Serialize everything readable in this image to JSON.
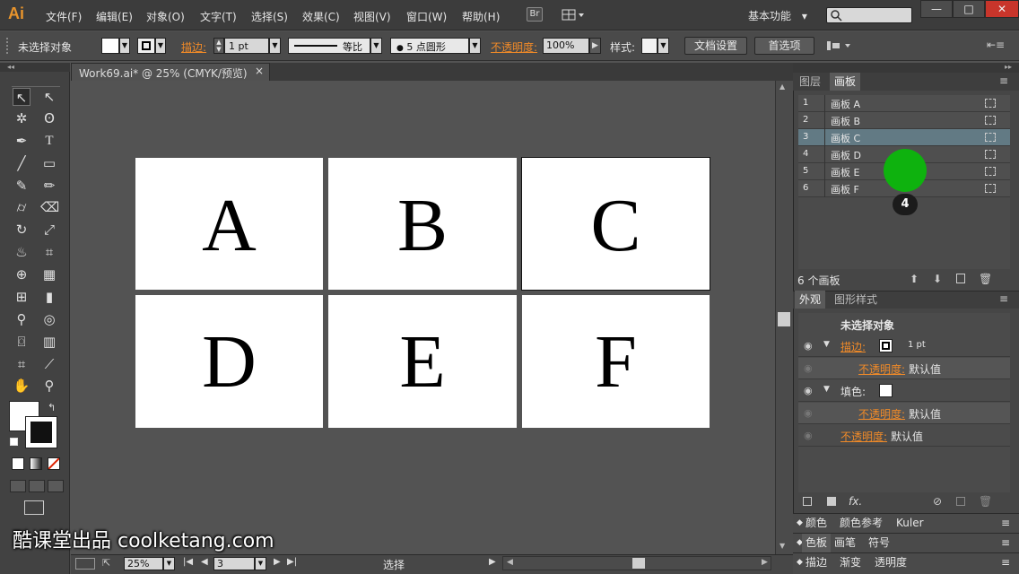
{
  "app": {
    "logo": "Ai"
  },
  "menu": [
    "文件(F)",
    "编辑(E)",
    "对象(O)",
    "文字(T)",
    "选择(S)",
    "效果(C)",
    "视图(V)",
    "窗口(W)",
    "帮助(H)"
  ],
  "bridge_button": "Br",
  "workspace": {
    "label": "基本功能",
    "chevron": "▾"
  },
  "window_controls": {
    "minimize": "—",
    "restore": "□",
    "close": "✕"
  },
  "control_bar": {
    "selection_status": "未选择对象",
    "stroke_label": "描边:",
    "stroke_weight": "1 pt",
    "stroke_profile": "等比",
    "brush": "5 点圆形",
    "opacity_label": "不透明度:",
    "opacity_value": "100%",
    "style_label": "样式:",
    "doc_setup_button": "文档设置",
    "preferences_button": "首选项"
  },
  "document": {
    "tab_title": "Work69.ai* @ 25% (CMYK/预览)",
    "close_glyph": "×"
  },
  "artboards": [
    {
      "label": "A"
    },
    {
      "label": "B"
    },
    {
      "label": "C"
    },
    {
      "label": "D"
    },
    {
      "label": "E"
    },
    {
      "label": "F"
    }
  ],
  "status_bar": {
    "zoom": "25%",
    "artboard_number": "3",
    "tool_status": "选择"
  },
  "panels": {
    "top_tabs": [
      "图层",
      "画板"
    ],
    "artboard_list": [
      {
        "num": "1",
        "name": "画板 A"
      },
      {
        "num": "2",
        "name": "画板 B"
      },
      {
        "num": "3",
        "name": "画板 C",
        "selected": true
      },
      {
        "num": "4",
        "name": "画板 D"
      },
      {
        "num": "5",
        "name": "画板 E"
      },
      {
        "num": "6",
        "name": "画板 F"
      }
    ],
    "artboard_count": "6 个画板",
    "appearance_tabs": [
      "外观",
      "图形样式"
    ],
    "appearance": {
      "title": "未选择对象",
      "stroke_label": "描边:",
      "stroke_value": "1 pt",
      "opacity_label": "不透明度:",
      "opacity_value": "默认值",
      "fill_label": "填色:",
      "fx": "fx."
    },
    "collapsed_1": [
      "颜色",
      "颜色参考",
      "Kuler"
    ],
    "collapsed_2": [
      "色板",
      "画笔",
      "符号"
    ],
    "collapsed_3": [
      "描边",
      "渐变",
      "透明度"
    ]
  },
  "overlay": {
    "click_badge": "4",
    "watermark": "酷课堂出品 coolketang.com"
  },
  "colors": {
    "accent_orange": "#f08a28",
    "selected_row": "#627a84",
    "cursor_green": "#0eb20e"
  }
}
